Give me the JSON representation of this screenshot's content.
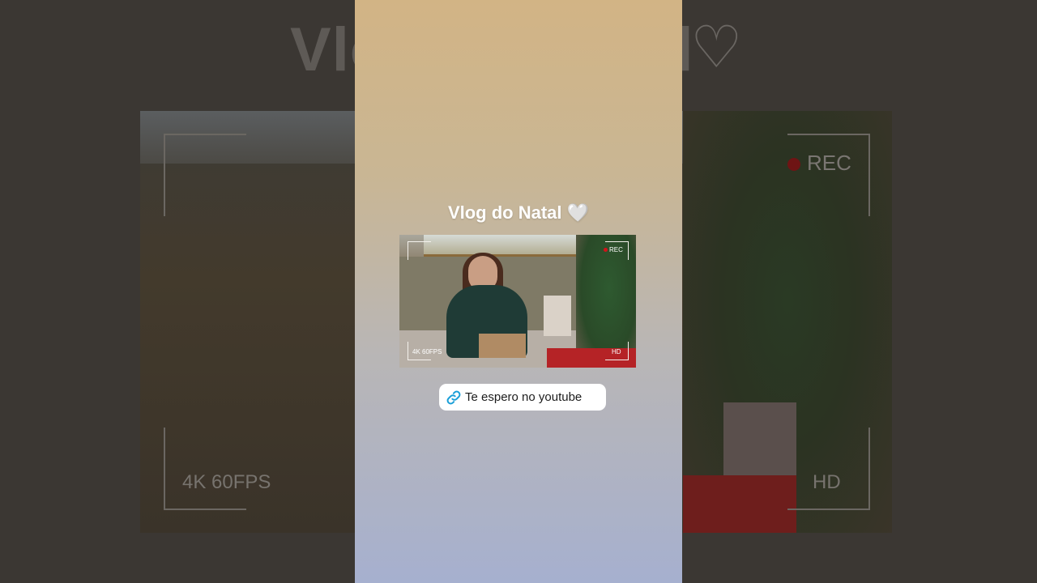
{
  "background": {
    "title": "Vlog do Natal",
    "rec_label": "REC",
    "fps_label": "4K 60FPS",
    "hd_label": "HD"
  },
  "story": {
    "title": "Vlog do Natal 🤍",
    "video": {
      "rec_label": "REC",
      "fps_label": "4K 60FPS",
      "hd_label": "HD"
    },
    "link_sticker": {
      "icon": "link-icon",
      "label": "Te espero no youtube"
    }
  },
  "colors": {
    "rec_dot": "#d1141b",
    "link_icon": "#1a9fd8"
  }
}
